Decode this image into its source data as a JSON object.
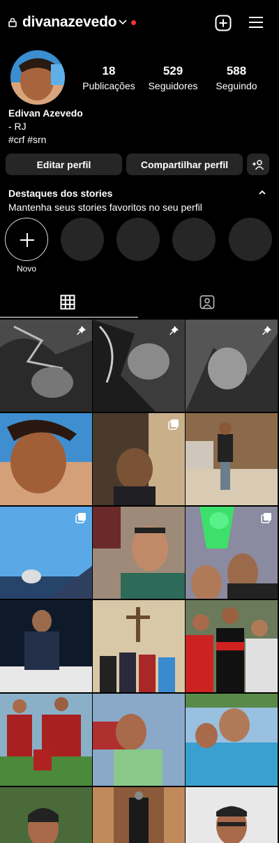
{
  "header": {
    "username": "divanazevedo",
    "icons": [
      "lock-icon",
      "chevron-down-icon",
      "notification-dot",
      "new-post-icon",
      "menu-icon"
    ]
  },
  "profile": {
    "stats": [
      {
        "value": "18",
        "label": "Publicações"
      },
      {
        "value": "529",
        "label": "Seguidores"
      },
      {
        "value": "588",
        "label": "Seguindo"
      }
    ],
    "name": "Edivan Azevedo",
    "bio_lines": [
      "- RJ",
      "#crf #srn"
    ]
  },
  "actions": {
    "edit": "Editar perfil",
    "share": "Compartilhar perfil",
    "add_person_icon": "add-person-icon"
  },
  "highlights": {
    "title": "Destaques dos stories",
    "subtitle": "Mantenha seus stories favoritos no seu perfil",
    "new_label": "Novo"
  },
  "tabs": [
    "grid-tab",
    "tagged-tab"
  ],
  "posts": {
    "pinned_count": 3,
    "multi_post_badges": [
      "1,1",
      "2,0",
      "2,2"
    ]
  },
  "colors": {
    "background": "#000000",
    "button": "#262626",
    "notification": "#ff3040"
  }
}
